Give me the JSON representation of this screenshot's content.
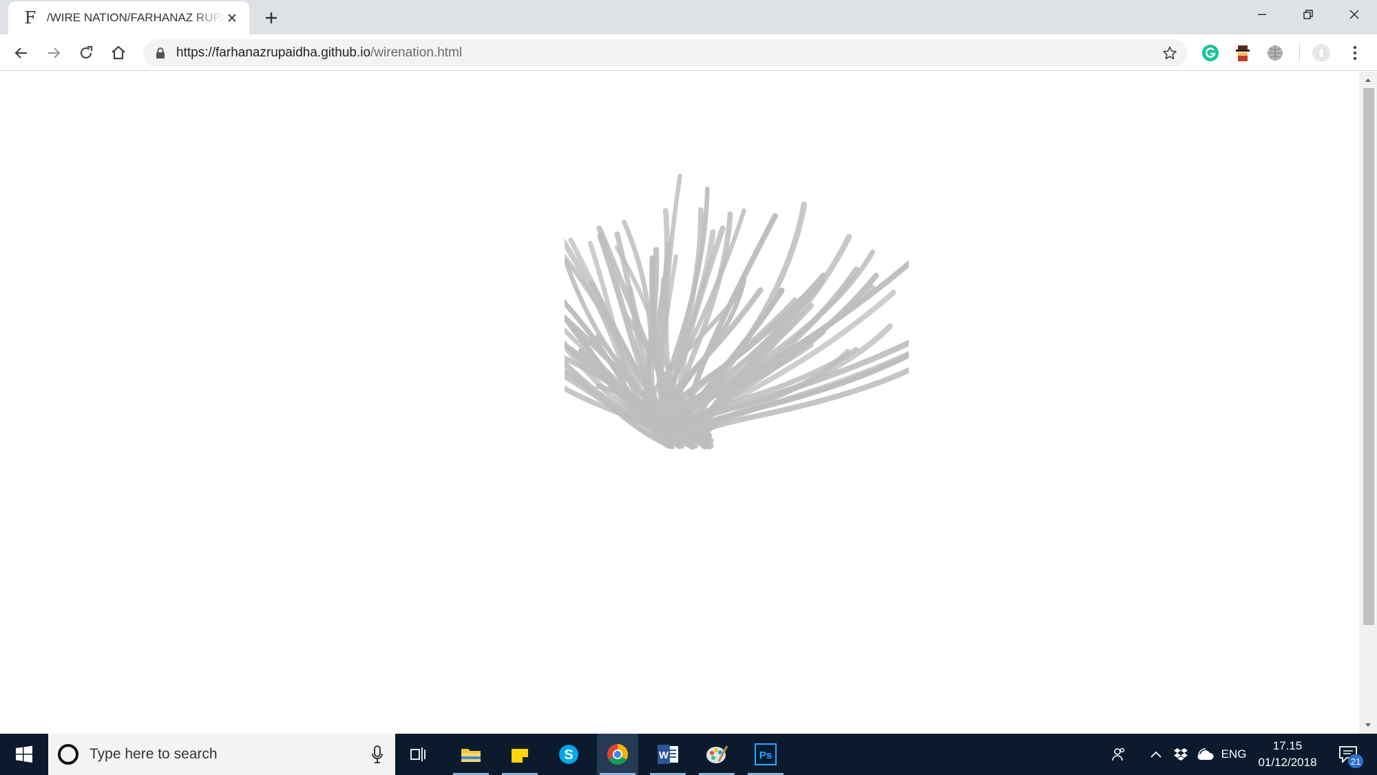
{
  "tab": {
    "title": "/WIRE NATION/FARHANAZ RUPAIDHA",
    "favicon_glyph": "F"
  },
  "address": {
    "host": "https://farhanazrupaidha.github.io",
    "path": "/wirenation.html"
  },
  "page": {
    "artwork_icon": "wire-sculpture",
    "stroke_color": "#bdbdbd"
  },
  "taskbar": {
    "search_placeholder": "Type here to search",
    "apps": [
      "task-view",
      "file-explorer",
      "sticky-notes",
      "skype",
      "chrome",
      "word",
      "paint",
      "photoshop"
    ],
    "word_label": "W",
    "photoshop_label": "Ps",
    "skype_label": "S",
    "language": "ENG",
    "time": "17.15",
    "date": "01/12/2018",
    "notifications": "21"
  },
  "colors": {
    "taskbar_bg": "#0b1a2c",
    "tabstrip_bg": "#dee1e6",
    "omnibox_bg": "#f1f3f4"
  }
}
